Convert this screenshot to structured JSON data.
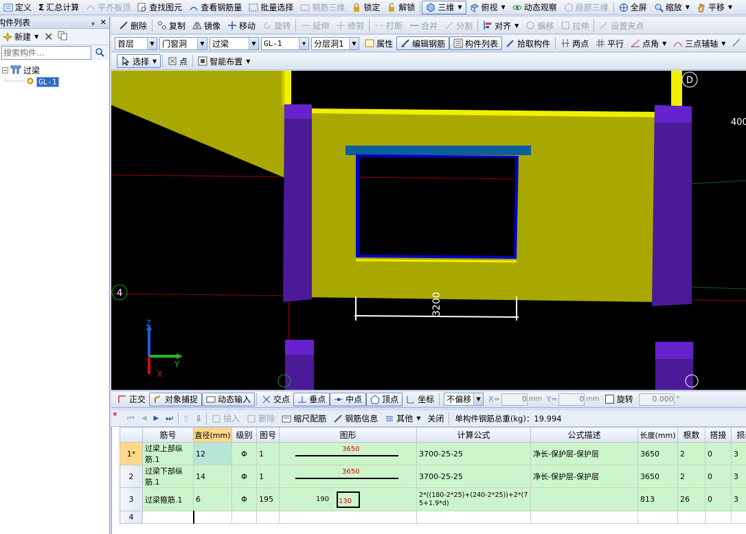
{
  "toolbar1": {
    "define": "定义",
    "sum_calc": "汇总计算",
    "align_slab": "平齐板顶",
    "find_elem": "查找图元",
    "view_rebar": "查看钢筋量",
    "batch_select": "批量选择",
    "rebar_3d": "钢筋三维",
    "lock": "锁定",
    "unlock": "解锁",
    "view_3d": "三维",
    "top_view": "俯视",
    "dynamic_observe": "动态观察",
    "local_3d": "局部三维",
    "fullscreen": "全屏",
    "zoom": "缩放",
    "pan": "平移"
  },
  "left_panel": {
    "title": "构件列表",
    "new_label": "新建",
    "search_placeholder": "搜索构件...",
    "tree_root": "过梁",
    "tree_child": "GL-1"
  },
  "toolbar2": {
    "delete": "删除",
    "copy": "复制",
    "mirror": "镜像",
    "move": "移动",
    "rotate": "旋转",
    "extend": "延伸",
    "trim": "修剪",
    "break": "打断",
    "merge": "合并",
    "split": "分割",
    "align": "对齐",
    "offset": "偏移",
    "stretch": "拉伸",
    "set_grip": "设置夹点"
  },
  "toolbar3": {
    "floor": "首层",
    "category": "门窗洞",
    "type": "过梁",
    "component": "GL-1",
    "layer": "分层洞1",
    "properties": "属性",
    "edit_rebar": "编辑钢筋",
    "component_list": "构件列表",
    "pick_component": "拾取构件",
    "two_points": "两点",
    "parallel": "平行",
    "point_angle": "点角",
    "three_point_axis": "三点辅轴"
  },
  "toolbar4": {
    "select": "选择",
    "point": "点",
    "smart_layout": "智能布置"
  },
  "viewport": {
    "dimension_label": "3200",
    "axis_left": "4",
    "axis_top_right": "D",
    "edge_number": "400",
    "axis_z": "Z",
    "axis_y": "Y",
    "axis_x": "X"
  },
  "snapbar": {
    "ortho": "正交",
    "object_snap": "对象捕捉",
    "dynamic_input": "动态输入",
    "intersection": "交点",
    "perpendicular": "垂点",
    "midpoint": "中点",
    "vertex": "顶点",
    "coordinate": "坐标",
    "offset_mode": "不偏移",
    "x_label": "X=",
    "x_value": "0",
    "y_label": "Y=",
    "y_value": "0",
    "unit": "mm",
    "rotate": "旋转",
    "rotate_value": "0.000",
    "degree": "°"
  },
  "rebar_toolbar": {
    "insert": "插入",
    "delete": "删除",
    "scale_rebar": "缩尺配筋",
    "rebar_info": "钢筋信息",
    "other": "其他",
    "close": "关闭",
    "total_weight_label": "单构件钢筋总重(kg)：19.994"
  },
  "rebar_table": {
    "headers": [
      "筋号",
      "直径(mm)",
      "级别",
      "图号",
      "图形",
      "计算公式",
      "公式描述",
      "长度(mm)",
      "根数",
      "搭接",
      "损耗"
    ],
    "rows": [
      {
        "index": "1*",
        "name": "过梁上部纵筋.1",
        "diameter": "12",
        "grade": "Φ",
        "shape_no": "1",
        "shape_value": "3650",
        "formula": "3700-25-25",
        "description": "净长-保护层-保护层",
        "length": "3650",
        "count": "2",
        "lap": "0",
        "loss": "3"
      },
      {
        "index": "2",
        "name": "过梁下部纵筋.1",
        "diameter": "14",
        "grade": "Φ",
        "shape_no": "1",
        "shape_value": "3650",
        "formula": "3700-25-25",
        "description": "净长-保护层-保护层",
        "length": "3650",
        "count": "2",
        "lap": "0",
        "loss": "3"
      },
      {
        "index": "3",
        "name": "过梁箍筋.1",
        "diameter": "6",
        "grade": "Φ",
        "shape_no": "195",
        "shape_side": "190",
        "shape_value": "130",
        "formula": "2*((180-2*25)+(240-2*25))+2*(75+1.9*d)",
        "description": "",
        "length": "813",
        "count": "26",
        "lap": "0",
        "loss": "3"
      },
      {
        "index": "4"
      }
    ]
  },
  "colors": {
    "beam_yellow": "#a8a800",
    "column_purple": "#4b1a99",
    "lintel_blue": "#0f5e9c",
    "dimension": "#ffffff"
  }
}
